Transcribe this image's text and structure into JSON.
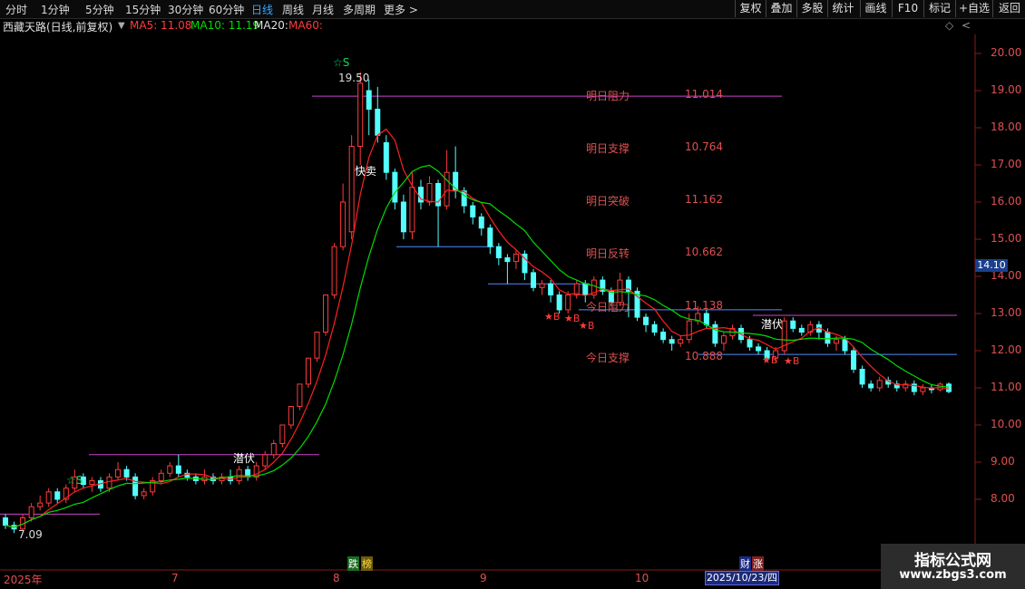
{
  "toolbar": {
    "tabs": [
      "分时",
      "1分钟",
      "5分钟",
      "15分钟",
      "30分钟",
      "60分钟",
      "日线",
      "周线",
      "月线",
      "多周期",
      "更多 >"
    ],
    "active_tab": "日线",
    "right_buttons": [
      "复权",
      "叠加",
      "多股",
      "统计",
      "画线",
      "F10",
      "标记",
      "+自选",
      "返回"
    ]
  },
  "info": {
    "title": "西藏天路(日线,前复权)",
    "ma5": "MA5: 11.08",
    "ma10": "MA10: 11.19",
    "ma20": "MA20:",
    "ma60": "MA60:",
    "diamond": "◇",
    "chevron": "<"
  },
  "yaxis": [
    "20.00",
    "19.00",
    "18.00",
    "17.00",
    "16.00",
    "15.00",
    "14.00",
    "13.00",
    "12.00",
    "11.00",
    "10.00",
    "9.00",
    "8.00"
  ],
  "current_price": "14.10",
  "xaxis": {
    "labels": [
      "2025年",
      "7",
      "8",
      "9",
      "10"
    ],
    "selected_date": "2025/10/23/四"
  },
  "annotations": {
    "high": "19.50",
    "low": "7.09",
    "fast_sell": "快卖",
    "qianfu": "潜伏",
    "signal_s": "☆S",
    "signal_b": "★B",
    "levels": [
      {
        "label": "明日阻力",
        "value": "11.014"
      },
      {
        "label": "明日支撑",
        "value": "10.764"
      },
      {
        "label": "明日突破",
        "value": "11.162"
      },
      {
        "label": "明日反转",
        "value": "10.662"
      },
      {
        "label": "今日阻力",
        "value": "11.138"
      },
      {
        "label": "今日支撑",
        "value": "10.888"
      }
    ],
    "tag_die": "跌",
    "tag_bang": "榜",
    "tag_cai": "财",
    "tag_zhang": "涨"
  },
  "watermark": {
    "line1": "指标公式网",
    "line2": "www.zbgs3.com"
  },
  "colors": {
    "up": "#ff3b3b",
    "down": "#54ffff",
    "ma5": "#ff2020",
    "ma10": "#00dd00",
    "axis_text": "#e05050",
    "level_line": "#cc44cc",
    "support_line": "#4f8cff"
  },
  "chart_data": {
    "type": "candlestick",
    "note_units": "price in CNY",
    "dates_range": [
      "2025-06",
      "2025-10-23"
    ],
    "ylim": [
      7.0,
      20.5
    ],
    "candles": [
      [
        7.5,
        7.3,
        7.6,
        7.2
      ],
      [
        7.3,
        7.2,
        7.4,
        7.09
      ],
      [
        7.2,
        7.5,
        7.6,
        7.15
      ],
      [
        7.5,
        7.8,
        7.9,
        7.4
      ],
      [
        7.8,
        7.9,
        8.1,
        7.7
      ],
      [
        7.9,
        8.2,
        8.3,
        7.8
      ],
      [
        8.2,
        8.0,
        8.3,
        7.9
      ],
      [
        8.0,
        8.3,
        8.4,
        7.9
      ],
      [
        8.3,
        8.6,
        8.8,
        8.2
      ],
      [
        8.6,
        8.4,
        8.7,
        8.3
      ],
      [
        8.4,
        8.5,
        8.6,
        8.2
      ],
      [
        8.5,
        8.3,
        8.6,
        8.2
      ],
      [
        8.3,
        8.6,
        8.7,
        8.2
      ],
      [
        8.6,
        8.8,
        9.0,
        8.5
      ],
      [
        8.8,
        8.6,
        8.9,
        8.5
      ],
      [
        8.6,
        8.1,
        8.7,
        8.0
      ],
      [
        8.1,
        8.2,
        8.3,
        8.0
      ],
      [
        8.2,
        8.5,
        8.6,
        8.1
      ],
      [
        8.5,
        8.7,
        8.8,
        8.4
      ],
      [
        8.7,
        8.9,
        9.0,
        8.6
      ],
      [
        8.9,
        8.7,
        9.2,
        8.6
      ],
      [
        8.7,
        8.6,
        8.8,
        8.5
      ],
      [
        8.6,
        8.5,
        8.7,
        8.4
      ],
      [
        8.5,
        8.6,
        8.8,
        8.4
      ],
      [
        8.6,
        8.5,
        8.7,
        8.4
      ],
      [
        8.5,
        8.6,
        8.7,
        8.4
      ],
      [
        8.6,
        8.5,
        8.8,
        8.4
      ],
      [
        8.5,
        8.8,
        8.9,
        8.4
      ],
      [
        8.8,
        8.6,
        8.9,
        8.5
      ],
      [
        8.6,
        8.9,
        9.0,
        8.5
      ],
      [
        8.9,
        9.2,
        9.3,
        8.8
      ],
      [
        9.2,
        9.5,
        9.6,
        9.1
      ],
      [
        9.5,
        10.0,
        10.0,
        9.4
      ],
      [
        10.0,
        10.5,
        10.5,
        9.9
      ],
      [
        10.5,
        11.1,
        11.1,
        10.4
      ],
      [
        11.1,
        11.8,
        11.8,
        11.0
      ],
      [
        11.8,
        12.5,
        12.5,
        11.7
      ],
      [
        12.5,
        13.5,
        13.5,
        12.4
      ],
      [
        13.5,
        14.8,
        14.9,
        13.4
      ],
      [
        14.8,
        16.0,
        16.5,
        14.7
      ],
      [
        15.2,
        17.5,
        17.8,
        15.0
      ],
      [
        17.5,
        19.2,
        19.5,
        17.0
      ],
      [
        19.0,
        18.5,
        19.3,
        17.8
      ],
      [
        18.5,
        17.8,
        19.1,
        17.6
      ],
      [
        17.6,
        16.8,
        17.8,
        16.6
      ],
      [
        16.8,
        16.0,
        16.9,
        15.8
      ],
      [
        16.0,
        15.2,
        16.2,
        15.0
      ],
      [
        15.2,
        16.4,
        16.8,
        15.0
      ],
      [
        16.4,
        16.0,
        16.6,
        15.8
      ],
      [
        16.0,
        16.5,
        16.7,
        15.9
      ],
      [
        16.5,
        15.9,
        16.6,
        14.8
      ],
      [
        15.9,
        16.8,
        17.4,
        15.8
      ],
      [
        16.8,
        16.3,
        17.5,
        16.1
      ],
      [
        16.3,
        15.9,
        16.4,
        15.7
      ],
      [
        15.9,
        15.6,
        16.0,
        15.4
      ],
      [
        15.6,
        15.3,
        15.7,
        15.1
      ],
      [
        15.3,
        14.8,
        15.4,
        14.6
      ],
      [
        14.8,
        14.5,
        14.9,
        14.3
      ],
      [
        14.5,
        14.4,
        14.6,
        13.8
      ],
      [
        14.4,
        14.6,
        14.7,
        14.2
      ],
      [
        14.6,
        14.1,
        14.7,
        13.9
      ],
      [
        14.1,
        13.7,
        14.2,
        13.6
      ],
      [
        13.7,
        13.8,
        13.9,
        13.5
      ],
      [
        13.8,
        13.5,
        13.9,
        13.3
      ],
      [
        13.5,
        13.1,
        13.6,
        13.0
      ],
      [
        13.1,
        13.5,
        13.6,
        13.0
      ],
      [
        13.5,
        13.8,
        13.9,
        13.4
      ],
      [
        13.8,
        13.5,
        13.9,
        13.3
      ],
      [
        13.5,
        13.9,
        14.0,
        13.4
      ],
      [
        13.9,
        13.6,
        14.0,
        13.5
      ],
      [
        13.6,
        13.3,
        13.7,
        13.2
      ],
      [
        13.3,
        13.9,
        14.1,
        13.2
      ],
      [
        13.9,
        13.6,
        14.0,
        12.9
      ],
      [
        13.6,
        12.9,
        13.7,
        12.8
      ],
      [
        12.9,
        12.7,
        13.0,
        12.5
      ],
      [
        12.7,
        12.5,
        12.8,
        12.4
      ],
      [
        12.5,
        12.3,
        12.6,
        12.2
      ],
      [
        12.3,
        12.2,
        12.4,
        12.0
      ],
      [
        12.2,
        12.3,
        12.4,
        12.1
      ],
      [
        12.3,
        12.8,
        13.0,
        12.2
      ],
      [
        12.8,
        13.0,
        13.2,
        12.7
      ],
      [
        13.0,
        12.7,
        13.1,
        12.6
      ],
      [
        12.7,
        12.2,
        12.8,
        12.1
      ],
      [
        12.2,
        12.4,
        12.5,
        12.0
      ],
      [
        12.4,
        12.6,
        12.7,
        12.3
      ],
      [
        12.6,
        12.3,
        12.7,
        12.2
      ],
      [
        12.3,
        12.1,
        12.4,
        12.0
      ],
      [
        12.1,
        12.0,
        12.2,
        11.9
      ],
      [
        12.0,
        11.8,
        12.1,
        11.7
      ],
      [
        11.8,
        12.0,
        12.1,
        11.7
      ],
      [
        12.0,
        12.8,
        12.9,
        11.9
      ],
      [
        12.8,
        12.6,
        12.9,
        12.5
      ],
      [
        12.6,
        12.5,
        12.7,
        12.4
      ],
      [
        12.5,
        12.7,
        12.8,
        12.4
      ],
      [
        12.7,
        12.5,
        12.8,
        12.3
      ],
      [
        12.5,
        12.2,
        12.6,
        12.1
      ],
      [
        12.2,
        12.3,
        12.4,
        12.0
      ],
      [
        12.3,
        12.0,
        12.4,
        11.9
      ],
      [
        12.0,
        11.5,
        12.1,
        11.4
      ],
      [
        11.5,
        11.1,
        11.6,
        11.0
      ],
      [
        11.1,
        11.0,
        11.2,
        10.9
      ],
      [
        11.0,
        11.2,
        11.3,
        10.9
      ],
      [
        11.2,
        11.1,
        11.3,
        11.0
      ],
      [
        11.1,
        11.0,
        11.2,
        10.9
      ],
      [
        11.0,
        11.1,
        11.2,
        10.9
      ],
      [
        11.1,
        10.9,
        11.2,
        10.8
      ],
      [
        10.9,
        11.0,
        11.1,
        10.8
      ],
      [
        11.0,
        10.95,
        11.1,
        10.85
      ],
      [
        10.95,
        11.1,
        11.15,
        10.9
      ],
      [
        11.1,
        10.9,
        11.15,
        10.85
      ]
    ],
    "ma5_label": "MA5",
    "ma10_label": "MA10"
  }
}
